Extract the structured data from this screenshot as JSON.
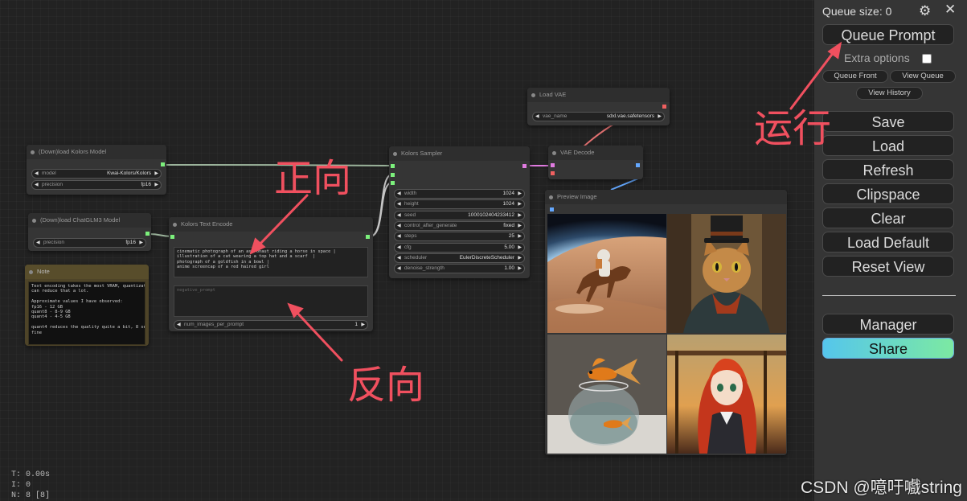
{
  "sidebar": {
    "queue_size": "Queue size: 0",
    "queue_prompt": "Queue Prompt",
    "extra_options": "Extra options",
    "queue_front": "Queue Front",
    "view_queue": "View Queue",
    "view_history": "View History",
    "save": "Save",
    "load": "Load",
    "refresh": "Refresh",
    "clipspace": "Clipspace",
    "clear": "Clear",
    "load_default": "Load Default",
    "reset_view": "Reset View",
    "manager": "Manager",
    "share": "Share"
  },
  "nodes": {
    "kolors_model": {
      "title": "(Down)load Kolors Model",
      "model_label": "model",
      "model_value": "Kwai-Kolors/Kolors",
      "precision_label": "precision",
      "precision_value": "fp16"
    },
    "chatglm": {
      "title": "(Down)load ChatGLM3 Model",
      "precision_label": "precision",
      "precision_value": "fp16"
    },
    "note": {
      "title": "Note",
      "text": "Text encoding takes the most VRAM, quantization\ncan reduce that a lot.\n\nApproximate values I have observed:\nfp16 - 12 GB\nquant8 - 8-9 GB\nquant4 - 4-5 GB\n\nquant4 reduces the quality quite a bit, 8 seems\nfine"
    },
    "text_encode": {
      "title": "Kolors Text Encode",
      "positive": "cinematic photograph of an astronaut riding a horse in space |\nillustration of a cat wearing a top hat and a scarf  |\nphotograph of a goldfish in a bowl |\nanime screencap of a red haired girl",
      "negative_placeholder": "negative_prompt",
      "num_label": "num_images_per_prompt",
      "num_value": "1"
    },
    "sampler": {
      "title": "Kolors Sampler",
      "widgets": [
        {
          "label": "width",
          "value": "1024"
        },
        {
          "label": "height",
          "value": "1024"
        },
        {
          "label": "seed",
          "value": "1000102404233412"
        },
        {
          "label": "control_after_generate",
          "value": "fixed"
        },
        {
          "label": "steps",
          "value": "25"
        },
        {
          "label": "cfg",
          "value": "5.00"
        },
        {
          "label": "scheduler",
          "value": "EulerDiscreteScheduler"
        },
        {
          "label": "denoise_strength",
          "value": "1.00"
        }
      ]
    },
    "load_vae": {
      "title": "Load VAE",
      "vae_label": "vae_name",
      "vae_value": "sdxl.vae.safetensors"
    },
    "vae_decode": {
      "title": "VAE Decode"
    },
    "preview": {
      "title": "Preview Image"
    }
  },
  "stats": {
    "t": "T: 0.00s",
    "i": "I: 0",
    "n": "N: 8 [8]"
  },
  "annotations": {
    "positive": "正向",
    "negative": "反向",
    "run": "运行"
  },
  "watermark": "CSDN @噫吁嚱string",
  "colors": {
    "annotation": "#f0505f",
    "port_green": "#7cf07c",
    "port_pink": "#e07be0",
    "port_red": "#f06060",
    "port_blue": "#64a8ff"
  }
}
